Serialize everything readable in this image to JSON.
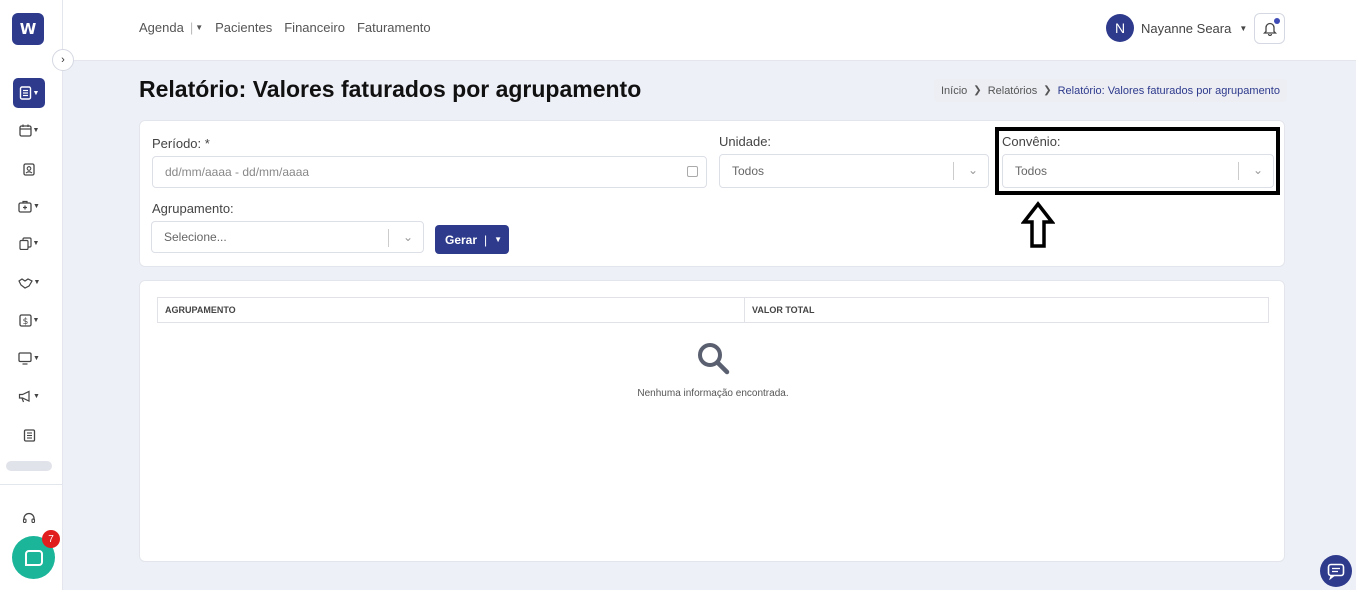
{
  "app": {
    "logo_letter": "W"
  },
  "topnav": {
    "items": [
      "Agenda",
      "Pacientes",
      "Financeiro",
      "Faturamento"
    ],
    "separator": "|"
  },
  "user": {
    "initial": "N",
    "name": "Nayanne Seara"
  },
  "page": {
    "title": "Relatório: Valores faturados por agrupamento"
  },
  "breadcrumb": {
    "items": [
      "Início",
      "Relatórios",
      "Relatório: Valores faturados por agrupamento"
    ]
  },
  "filters": {
    "periodo": {
      "label": "Período: *",
      "placeholder": "dd/mm/aaaa - dd/mm/aaaa"
    },
    "unidade": {
      "label": "Unidade:",
      "value": "Todos"
    },
    "convenio": {
      "label": "Convênio:",
      "value": "Todos"
    },
    "agrupamento": {
      "label": "Agrupamento:",
      "placeholder": "Selecione..."
    },
    "gerar_label": "Gerar",
    "gerar_separator": "|"
  },
  "table": {
    "columns": [
      "AGRUPAMENTO",
      "VALOR TOTAL"
    ],
    "empty_message": "Nenhuma informação encontrada."
  },
  "chat": {
    "badge_count": "7"
  },
  "colors": {
    "primary": "#2e3a8c",
    "chat": "#1bb59a",
    "badge": "#e01e1e",
    "background": "#eef0f8"
  }
}
